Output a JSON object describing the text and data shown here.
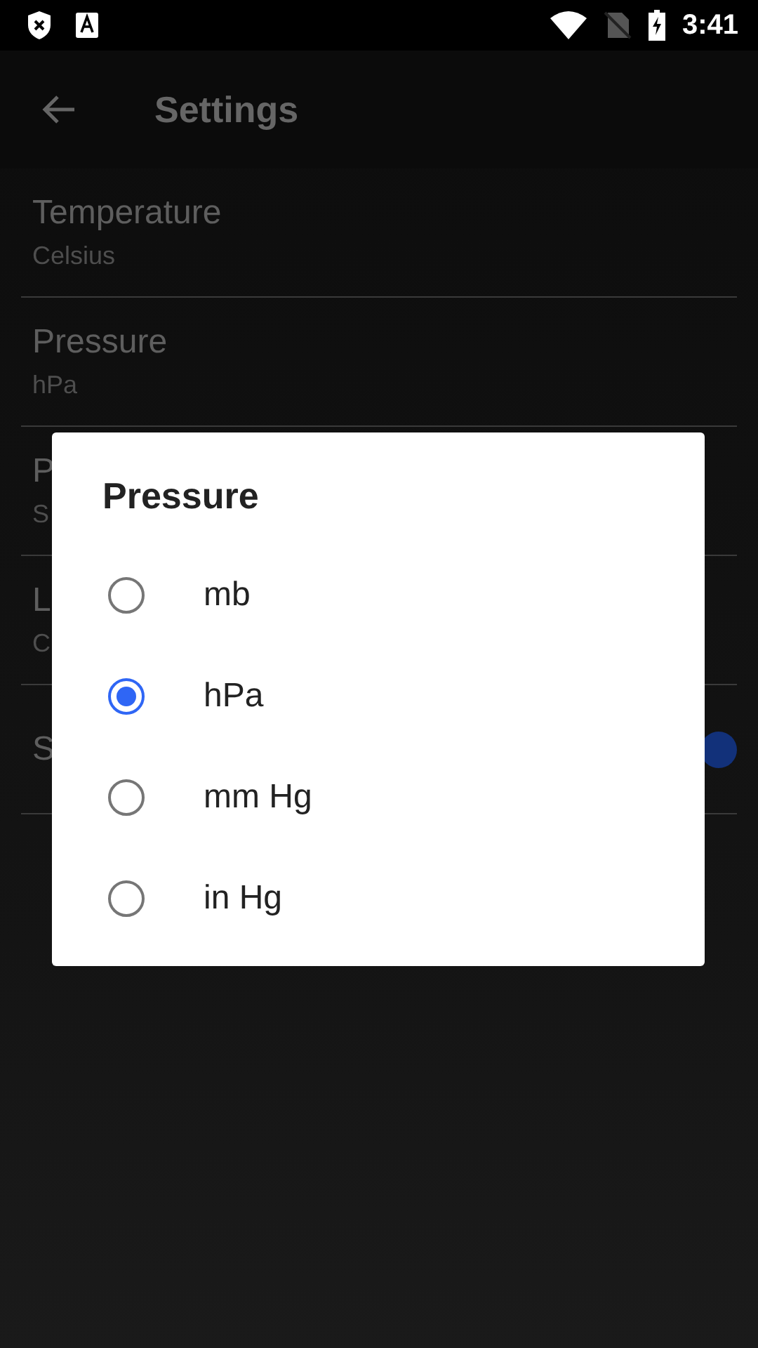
{
  "status_bar": {
    "time": "3:41"
  },
  "app_bar": {
    "title": "Settings"
  },
  "settings": [
    {
      "kind": "text",
      "title": "Temperature",
      "summary": "Celsius"
    },
    {
      "kind": "text",
      "title": "Pressure",
      "summary": "hPa"
    },
    {
      "kind": "text",
      "title": "P",
      "summary": "S"
    },
    {
      "kind": "text",
      "title": "L",
      "summary": "C"
    },
    {
      "kind": "switch",
      "title": "S",
      "on": true
    }
  ],
  "dialog": {
    "title": "Pressure",
    "options": [
      {
        "label": "mb",
        "selected": false
      },
      {
        "label": "hPa",
        "selected": true
      },
      {
        "label": "mm Hg",
        "selected": false
      },
      {
        "label": "in Hg",
        "selected": false
      }
    ]
  }
}
